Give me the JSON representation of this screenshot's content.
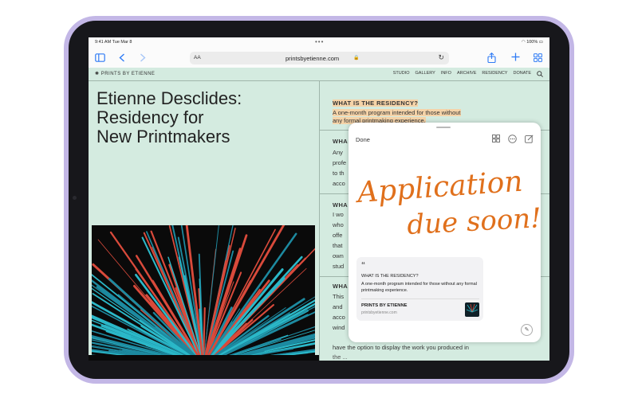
{
  "status_bar": {
    "time": "9:41 AM  Tue Mar 8",
    "battery": "100%"
  },
  "toolbar": {
    "aa_label": "AA",
    "url": "printsbyetienne.com",
    "icons": [
      "sidebar-icon",
      "back-icon",
      "forward-icon",
      "lock-icon",
      "reload-icon",
      "share-icon",
      "new-tab-icon",
      "tabs-grid-icon"
    ]
  },
  "site": {
    "brand": "PRINTS BY ETIENNE",
    "nav": [
      "STUDIO",
      "GALLERY",
      "INFO",
      "ARCHIVE",
      "RESIDENCY",
      "DONATE"
    ],
    "headline": [
      "Etienne Desclides:",
      "Residency for",
      "New Printmakers"
    ],
    "sections": [
      {
        "heading": "WHAT IS THE RESIDENCY?",
        "text": [
          "A one-month program intended for those without",
          "any formal printmaking experience."
        ]
      },
      {
        "heading": "WHA",
        "text": [
          "Any",
          "profe",
          "to th",
          "acco"
        ]
      },
      {
        "heading": "WHA",
        "text": [
          "I wo",
          "who",
          "offe",
          "that",
          "own",
          "stud"
        ]
      },
      {
        "heading": "WHA",
        "text": [
          "This",
          "and",
          "acco",
          "wind"
        ]
      }
    ],
    "bottom_text": [
      "have the option to display the work you produced in",
      "the ..."
    ]
  },
  "quick_note": {
    "done_label": "Done",
    "handwriting": [
      "Application",
      "due soon!"
    ],
    "ink_color": "#e0701c",
    "link_card": {
      "quote_mark": "“",
      "title": "WHAT IS THE RESIDENCY?",
      "body": "A one-month program intended for those without any formal printmaking experience.",
      "site_name": "PRINTS BY ETIENNE",
      "site_url": "printsbyetienne.com"
    }
  },
  "colors": {
    "page_bg": "#d4ebe0",
    "accent": "#2f7bf5",
    "highlight": "#f5d3a8",
    "device": "#c3b7e6"
  }
}
